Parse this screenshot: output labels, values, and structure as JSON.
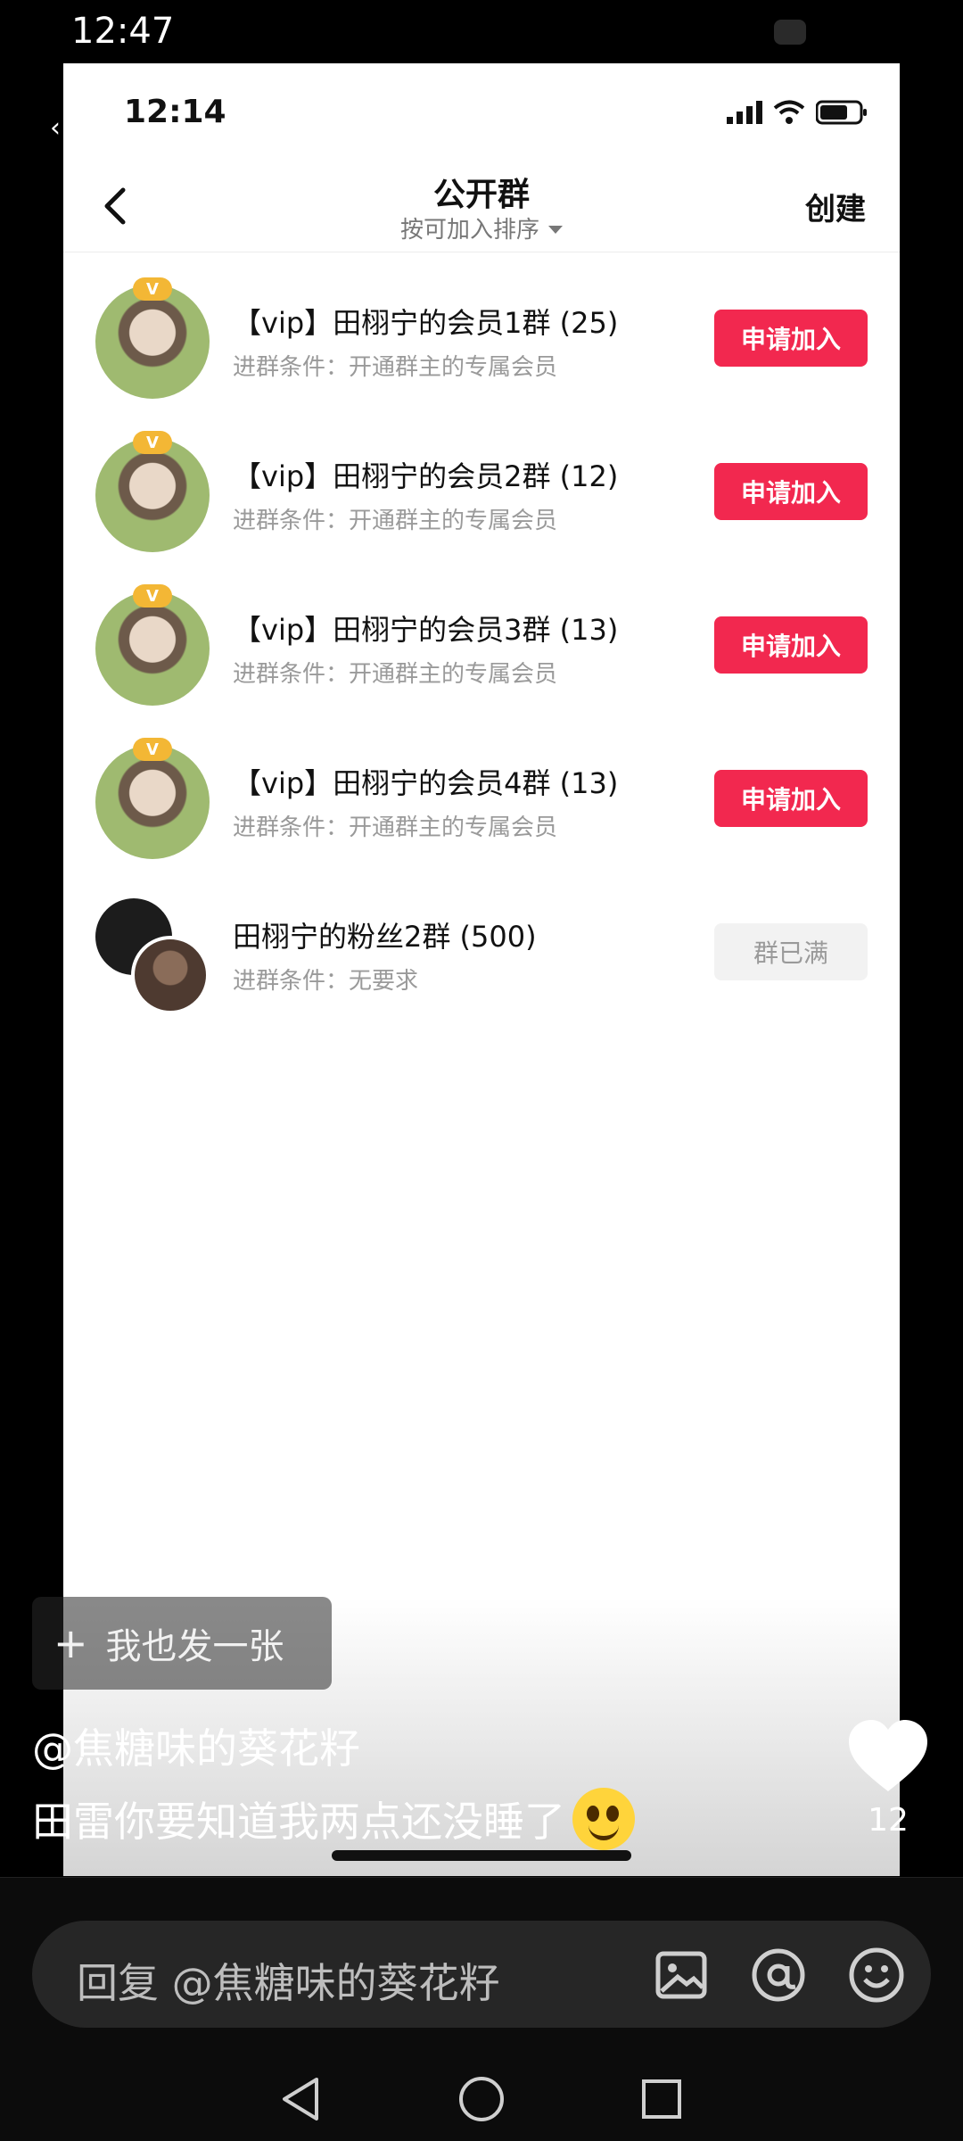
{
  "outer_status": {
    "time": "12:47"
  },
  "inner_status": {
    "time": "12:14"
  },
  "topbar": {
    "title": "公开群",
    "sort_label": "按可加入排序",
    "create_label": "创建"
  },
  "groups": [
    {
      "title": "【vip】田栩宁的会员1群 (25)",
      "condition": "进群条件：开通群主的专属会员",
      "action": "申请加入",
      "badge": "V"
    },
    {
      "title": "【vip】田栩宁的会员2群 (12)",
      "condition": "进群条件：开通群主的专属会员",
      "action": "申请加入",
      "badge": "V"
    },
    {
      "title": "【vip】田栩宁的会员3群 (13)",
      "condition": "进群条件：开通群主的专属会员",
      "action": "申请加入",
      "badge": "V"
    },
    {
      "title": "【vip】田栩宁的会员4群 (13)",
      "condition": "进群条件：开通群主的专属会员",
      "action": "申请加入",
      "badge": "V"
    },
    {
      "title": "田栩宁的粉丝2群 (500)",
      "condition": "进群条件：无要求",
      "action": "群已满"
    }
  ],
  "overlay": {
    "also_post": "我也发一张",
    "mention": "@焦糖味的葵花籽",
    "comment": "田雷你要知道我两点还没睡了",
    "like_count": "12"
  },
  "reply": {
    "placeholder": "回复 @焦糖味的葵花籽"
  },
  "colors": {
    "accent": "#f2284f",
    "disabled_bg": "#f2f2f2",
    "badge": "#f3b735"
  }
}
